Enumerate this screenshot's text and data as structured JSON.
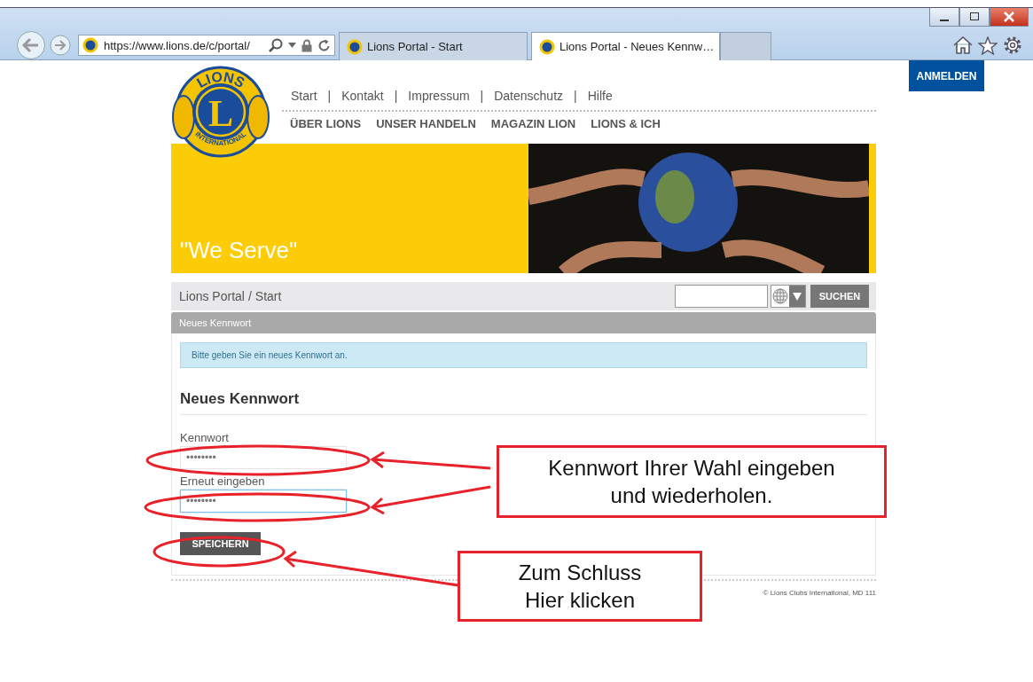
{
  "browser": {
    "address": "https://www.lions.de/c/portal/",
    "tabs": [
      {
        "title": "Lions Portal - Start",
        "selected": false
      },
      {
        "title": "Lions Portal - Neues Kennw…",
        "selected": true
      }
    ]
  },
  "logo": {
    "top": "LIONS",
    "letter": "L",
    "bottom": "INTERNATIONAL"
  },
  "header": {
    "login": "ANMELDEN",
    "separator": "|",
    "top_links": [
      "Start",
      "Kontakt",
      "Impressum",
      "Datenschutz",
      "Hilfe"
    ],
    "main_nav": [
      "ÜBER LIONS",
      "UNSER HANDELN",
      "MAGAZIN LION",
      "LIONS & ICH"
    ]
  },
  "banner": {
    "slogan": "\"We Serve\""
  },
  "breadcrumb": {
    "separator": "/",
    "items": [
      "Lions Portal",
      "Start"
    ]
  },
  "search": {
    "button": "SUCHEN"
  },
  "portlet": {
    "title": "Neues Kennwort",
    "alert": "Bitte geben Sie ein neues Kennwort an.",
    "heading": "Neues Kennwort",
    "fields": [
      {
        "label": "Kennwort",
        "value": "••••••••",
        "focused": false
      },
      {
        "label": "Erneut eingeben",
        "value": "••••••••",
        "focused": true
      }
    ],
    "submit": "SPEICHERN"
  },
  "footer": "© Lions Clubs International, MD 111",
  "annotations": [
    {
      "text": "Kennwort Ihrer Wahl eingeben\nund wiederholen."
    },
    {
      "text": "Zum Schluss\nHier klicken"
    }
  ]
}
